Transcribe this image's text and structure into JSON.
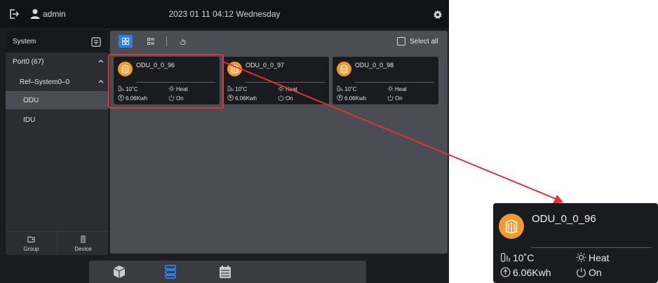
{
  "topbar": {
    "username": "admin",
    "datetime": "2023 01 11 04:12 Wednesday"
  },
  "sidebar": {
    "header_label": "System",
    "items": [
      {
        "label": "Port0 (67)",
        "expanded": true
      },
      {
        "label": "Ref–System0–0",
        "expanded": true
      },
      {
        "label": "ODU",
        "selected": true
      },
      {
        "label": "IDU",
        "selected": false
      }
    ],
    "footer": [
      {
        "label": "Group",
        "icon": "folder-icon"
      },
      {
        "label": "Device",
        "icon": "device-icon"
      }
    ]
  },
  "toolbar": {
    "select_all_label": "Select all",
    "select_all_checked": false,
    "active_view": "grid"
  },
  "cards": [
    {
      "name": "ODU_0_0_96",
      "temp": "10˚C",
      "mode": "Heat",
      "energy": "6.06Kwh",
      "power": "On"
    },
    {
      "name": "ODU_0_0_97",
      "temp": "10˚C",
      "mode": "Heat",
      "energy": "6.06Kwh",
      "power": "On"
    },
    {
      "name": "ODU_0_0_98",
      "temp": "10˚C",
      "mode": "Heat",
      "energy": "6.06Kwh",
      "power": "On"
    }
  ],
  "zoom": {
    "name": "ODU_0_0_96",
    "temp": "10˚C",
    "mode": "Heat",
    "energy": "6.06Kwh",
    "power": "On"
  },
  "colors": {
    "accent": "#2b7fe8",
    "device_orange": "#f39a2e",
    "highlight_red": "#d83a3a"
  }
}
